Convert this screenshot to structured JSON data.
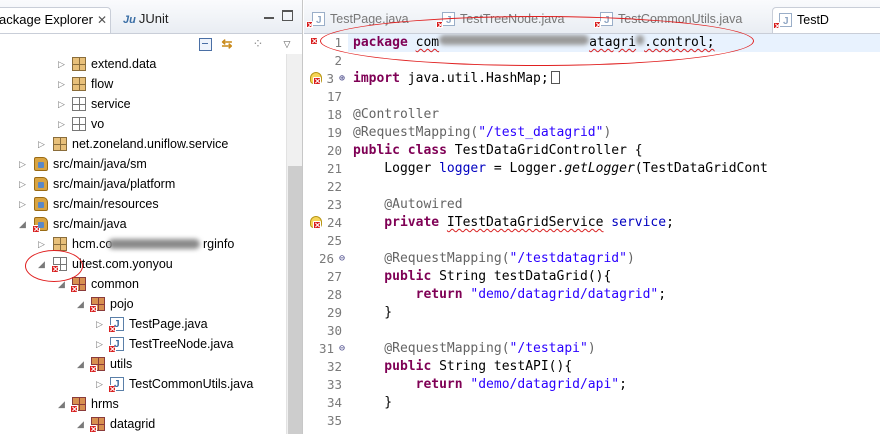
{
  "package_explorer": {
    "tab_title": "ackage Explorer",
    "close_glyph": "✕",
    "junit_tab_prefix": "Ju",
    "junit_tab_label": "JUnit",
    "toolbar": [
      "collapse-all-icon",
      "link-with-editor-icon",
      "view-options-icon",
      "view-menu-icon"
    ],
    "tree": [
      {
        "label": "extend.data"
      },
      {
        "label": "flow"
      },
      {
        "label": "service"
      },
      {
        "label": "vo"
      },
      {
        "label": "net.zoneland.uniflow.service"
      },
      {
        "label": "src/main/java/sm"
      },
      {
        "label": "src/main/java/platform"
      },
      {
        "label": "src/main/resources"
      },
      {
        "label": "src/main/java"
      },
      {
        "label": "hcm.co",
        "label_tail": "rginfo"
      },
      {
        "label": "uitest.com.yonyou"
      },
      {
        "label": "common"
      },
      {
        "label": "pojo"
      },
      {
        "label": "TestPage.java"
      },
      {
        "label": "TestTreeNode.java"
      },
      {
        "label": "utils"
      },
      {
        "label": "TestCommonUtils.java"
      },
      {
        "label": "hrms"
      },
      {
        "label": "datagrid"
      }
    ]
  },
  "editor": {
    "tabs": [
      {
        "label": "TestPage.java"
      },
      {
        "label": "TestTreeNode.java"
      },
      {
        "label": "TestCommonUtils.java"
      },
      {
        "label": "TestD"
      }
    ],
    "line_numbers": [
      "1",
      "2",
      "3",
      "17",
      "18",
      "19",
      "20",
      "21",
      "22",
      "23",
      "24",
      "25",
      "26",
      "27",
      "28",
      "29",
      "30",
      "31",
      "32",
      "33",
      "34",
      "35"
    ],
    "fold_glyph": "⊕",
    "code": {
      "l1_kw": "package",
      "l1_a": "com",
      "l1_b": "atagri",
      "l1_c": ".control;",
      "l3_kw": "import",
      "l3_rest": " java.util.HashMap;",
      "l18": "@Controller",
      "l19_ann": "@RequestMapping(",
      "l19_str": "\"/test_datagrid\"",
      "l19_end": ")",
      "l20_kw": "public class",
      "l20_rest": " TestDataGridController {",
      "l21_a": "    Logger ",
      "l21_fld": "logger",
      "l21_b": " = Logger.",
      "l21_it": "getLogger",
      "l21_c": "(TestDataGridCont",
      "l23": "    @Autowired",
      "l24_kw": "    private",
      "l24_type": "ITestDataGridService",
      "l24_fld": "service",
      "l24_end": ";",
      "l26_ann": "    @RequestMapping(",
      "l26_str": "\"/testdatagrid\"",
      "l26_end": ")",
      "l27_kw": "    public",
      "l27_rest": " String testDataGrid(){",
      "l28_kw": "        return",
      "l28_str": "\"demo/datagrid/datagrid\"",
      "l28_end": ";",
      "l29": "    }",
      "l31_ann": "    @RequestMapping(",
      "l31_str": "\"/testapi\"",
      "l31_end": ")",
      "l32_kw": "    public",
      "l32_rest": " String testAPI(){",
      "l33_kw": "        return",
      "l33_str": "\"demo/datagrid/api\"",
      "l33_end": ";",
      "l34": "    }"
    }
  },
  "colors": {
    "keyword": "#7f0055",
    "string": "#2a00ff",
    "annotation": "#646464",
    "field": "#0000c0",
    "annotation_circle": "#e02020"
  }
}
